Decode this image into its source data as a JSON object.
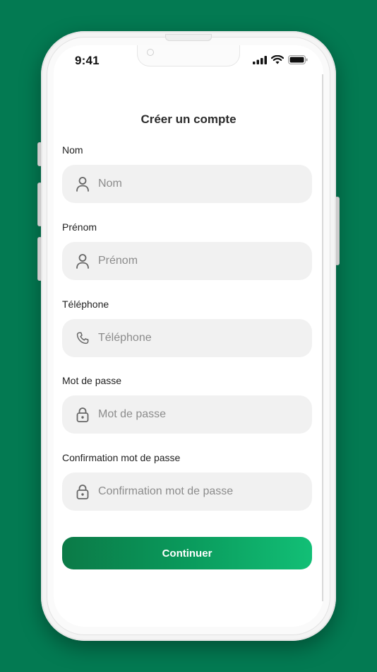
{
  "status_bar": {
    "time": "9:41",
    "icons": [
      "cellular-signal-icon",
      "wifi-icon",
      "battery-icon"
    ]
  },
  "page": {
    "title": "Créer un compte"
  },
  "form": {
    "fields": [
      {
        "label": "Nom",
        "placeholder": "Nom",
        "icon": "user-icon"
      },
      {
        "label": "Prénom",
        "placeholder": "Prénom",
        "icon": "user-icon"
      },
      {
        "label": "Téléphone",
        "placeholder": "Téléphone",
        "icon": "phone-icon"
      },
      {
        "label": "Mot de passe",
        "placeholder": "Mot de passe",
        "icon": "lock-icon"
      },
      {
        "label": "Confirmation mot de passe",
        "placeholder": "Confirmation mot de passe",
        "icon": "lock-icon"
      }
    ],
    "submit_label": "Continuer"
  },
  "colors": {
    "background": "#037a52",
    "button_gradient_start": "#0b7a47",
    "button_gradient_end": "#12bf76",
    "field_background": "#f1f1f1"
  }
}
